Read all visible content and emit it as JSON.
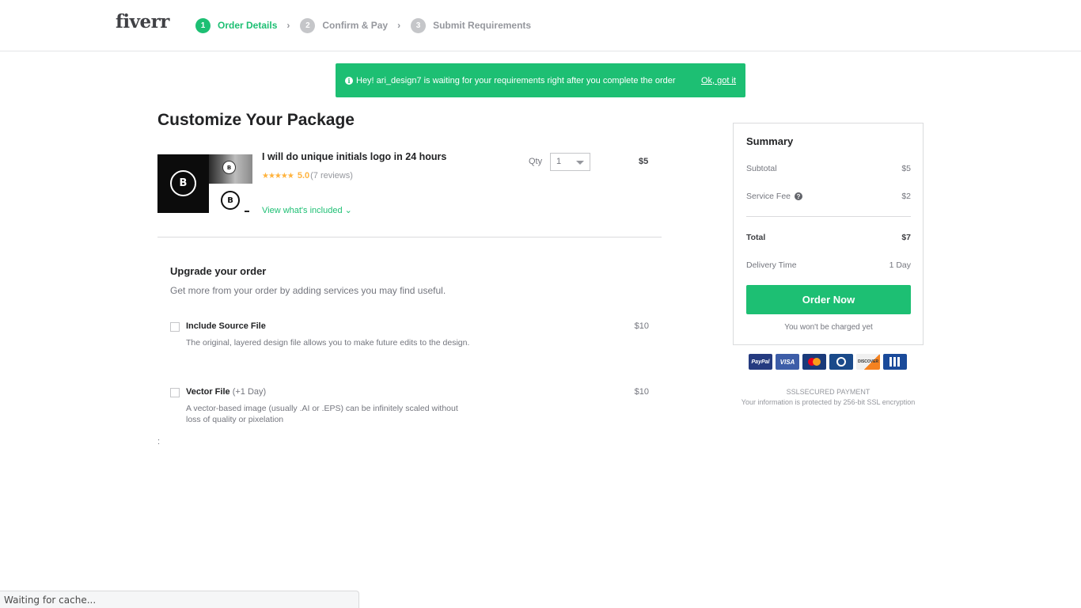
{
  "header": {
    "logo": "fiverr",
    "steps": [
      {
        "num": "1",
        "label": "Order Details",
        "active": true
      },
      {
        "num": "2",
        "label": "Confirm & Pay",
        "active": false
      },
      {
        "num": "3",
        "label": "Submit Requirements",
        "active": false
      }
    ],
    "step_separator": "›"
  },
  "banner": {
    "icon": "info-icon",
    "icon_glyph": "i",
    "message": "Hey! ari_design7 is waiting for your requirements right after you complete the order",
    "dismiss_label": "Ok, got it"
  },
  "main": {
    "title": "Customize Your Package",
    "gig": {
      "title": "I will do unique initials logo in 24 hours",
      "stars": "★★★★★",
      "rating": "5.0",
      "reviews": "(7 reviews)",
      "view_included": "View what's included ⌄",
      "image_monogram": "B",
      "qty_label": "Qty",
      "qty_value": "1",
      "price": "$5"
    },
    "upgrade": {
      "title": "Upgrade your order",
      "subtitle": "Get more from your order by adding services you may find useful.",
      "extras": [
        {
          "name": "Include Source File",
          "note": "",
          "description": "The original, layered design file allows you to make future edits to the design.",
          "price": "$10",
          "checked": false
        },
        {
          "name": "Vector File",
          "note": " (+1 Day)",
          "description": "A vector-based image (usually .AI or .EPS) can be infinitely scaled without loss of quality or pixelation",
          "price": "$10",
          "checked": false
        }
      ]
    },
    "stray_text": ":"
  },
  "summary": {
    "title": "Summary",
    "subtotal_label": "Subtotal",
    "subtotal_value": "$5",
    "service_fee_label": "Service Fee",
    "service_fee_help": "?",
    "service_fee_value": "$2",
    "total_label": "Total",
    "total_value": "$7",
    "delivery_label": "Delivery Time",
    "delivery_value": "1 Day",
    "order_button": "Order Now",
    "note": "You won't be charged yet"
  },
  "payments": {
    "methods": [
      "PayPal",
      "VISA",
      "Maestro",
      "Diners Club",
      "DISCOVER",
      "JCB"
    ],
    "ssl_title": "SSLSECURED PAYMENT",
    "ssl_desc": "Your information is protected by 256-bit SSL encryption"
  },
  "colors": {
    "brand_green": "#1dbf73",
    "star_yellow": "#ffb33e",
    "text_dark": "#222325",
    "text_muted": "#74767e"
  },
  "statusbar": {
    "text": "Waiting for cache..."
  }
}
